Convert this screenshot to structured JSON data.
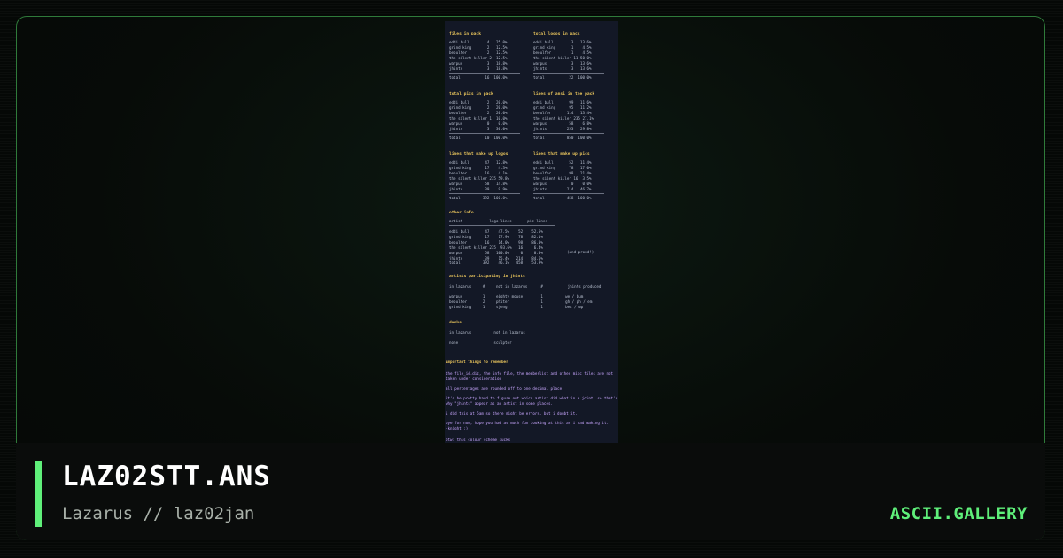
{
  "file": {
    "name": "LAZ02STT.ANS",
    "credit": "Lazarus // laz02jan"
  },
  "site": {
    "brand": "ASCII.GALLERY"
  },
  "colors": {
    "accent": "#5ff07a",
    "frame_border": "#2f7a3a",
    "art_background": "#131826",
    "art_heading": "#e8c45c",
    "art_text": "#b8c0d0",
    "art_note": "#c9a7ff"
  },
  "art": {
    "sections": [
      {
        "id": "files",
        "title": "files in pack",
        "rows": [
          "eddi bull        4   25.0%",
          "grind king       2   12.5%",
          "beoulfer         2   12.5%",
          "the silent killer 2  12.5%",
          "warpus           3   18.8%",
          "jhints           3   18.8%"
        ],
        "total": "total           16  100.0%"
      },
      {
        "id": "logos",
        "title": "total logos in pack",
        "rows": [
          "eddi bull        3   13.6%",
          "grind king       1    4.5%",
          "beoulfer         1    4.5%",
          "the silent killer 11 50.0%",
          "warpus           3   13.6%",
          "jhints           3   13.6%"
        ],
        "total": "total           22  100.0%"
      },
      {
        "id": "pics",
        "title": "total pics in pack",
        "rows": [
          "eddi bull        2   20.0%",
          "grind king       2   20.0%",
          "beoulfer         2   20.0%",
          "the silent killer 1  10.0%",
          "warpus           0    0.0%",
          "jhints           3   30.0%"
        ],
        "total": "total           10  100.0%"
      },
      {
        "id": "lines",
        "title": "lines of ansi in the pack",
        "rows": [
          "eddi bull       99   11.6%",
          "grind king      95   11.2%",
          "beoulfer       114   13.4%",
          "the silent killer 235 27.1%",
          "warpus          58    6.8%",
          "jhints         253   29.8%"
        ],
        "total": "total          850  100.0%"
      },
      {
        "id": "logolines",
        "title": "lines that make up logos",
        "rows": [
          "eddi bull       47   12.8%",
          "grind king      17    4.3%",
          "beoulfer        16    4.1%",
          "the silent killer 235 59.8%",
          "warpus          58   14.8%",
          "jhints          39    9.9%"
        ],
        "total": "total          392  100.0%"
      },
      {
        "id": "piclines",
        "title": "lines that make up pics",
        "rows": [
          "eddi bull       52   11.4%",
          "grind king      78   17.0%",
          "beoulfer        98   21.4%",
          "the silent killer 16  3.5%",
          "warpus           0    0.0%",
          "jhints         214   46.7%"
        ],
        "total": "total          458  100.0%"
      }
    ],
    "other_info": {
      "title": "other info",
      "header": "artist            logo lines       pic lines",
      "rows": [
        "eddi bull       47    47.5%    52    52.5%",
        "grind king      17    17.9%    78    82.1%",
        "beoulfer        16    14.0%    98    86.0%",
        "the silent killer 235  93.6%   16     6.4%",
        "warpus          58   100.0%     0     0.0%",
        "jhints          39    15.4%   214    84.6%",
        "total          392    46.1%   458    53.9%"
      ],
      "aside": "(and proud!)"
    },
    "participation": {
      "title": "artists participating in jhints",
      "header": "in lazarus     #     not in lazarus      #           jhints produced",
      "rows": [
        "warpus         1     eighty mouse        1          we / bum",
        "beoulfer       2     phiter              1          gh / ph / em",
        "grind king     1     sjeng               1          bes / wp"
      ]
    },
    "ducks": {
      "title": "ducks",
      "header": "in lazarus          not in lazarus",
      "rows": [
        "none                sculptor"
      ]
    },
    "notes": {
      "title": "important things to remember",
      "lines": [
        "the file_id.diz, the info file, the memberlist and other misc files are not",
        "taken under consideration",
        "all percentages are rounded off to one decimal place",
        "it'd be pretty hard to figure out which artist did what in a joint, so that's",
        "why \"jhints\" appear as an artist in some places.",
        "i did this at 5am so there might be errors, but i doubt it.",
        "bye for now, hope you had as much fun looking at this as i had making it.",
        "-knight :)",
        "btw: this colour scheme sucks"
      ]
    }
  }
}
